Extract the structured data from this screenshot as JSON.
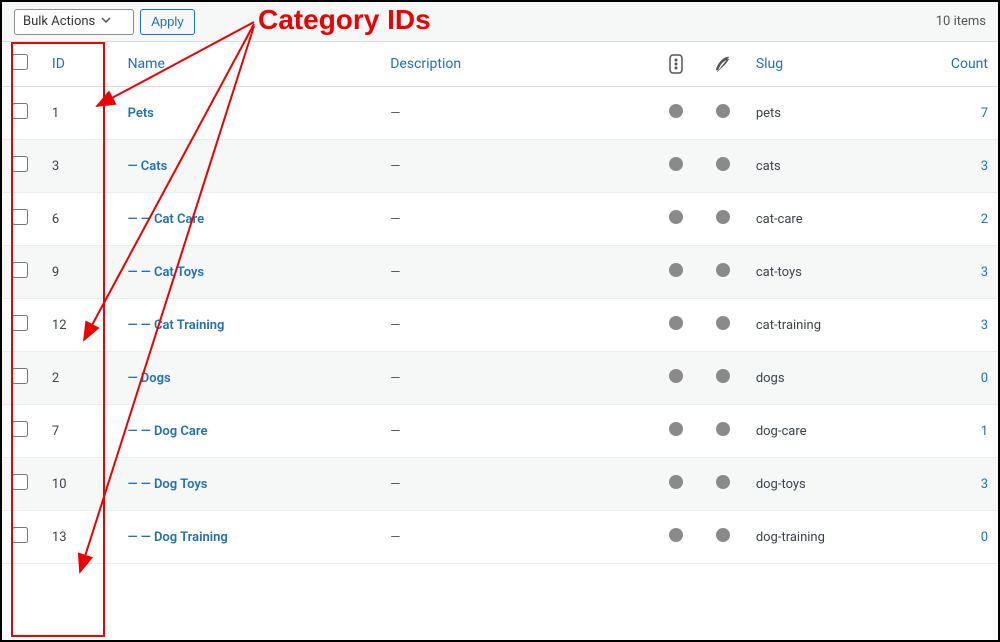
{
  "toolbar": {
    "bulk_actions_label": "Bulk Actions",
    "apply_label": "Apply",
    "items_count": "10 items"
  },
  "headers": {
    "id": "ID",
    "name": "Name",
    "description": "Description",
    "slug": "Slug",
    "count": "Count"
  },
  "rows": [
    {
      "id": "1",
      "indent": 0,
      "name": "Pets",
      "description": "—",
      "slug": "pets",
      "count": "7"
    },
    {
      "id": "3",
      "indent": 1,
      "name": "Cats",
      "description": "—",
      "slug": "cats",
      "count": "3"
    },
    {
      "id": "6",
      "indent": 2,
      "name": "Cat Care",
      "description": "—",
      "slug": "cat-care",
      "count": "2"
    },
    {
      "id": "9",
      "indent": 2,
      "name": "Cat Toys",
      "description": "—",
      "slug": "cat-toys",
      "count": "3"
    },
    {
      "id": "12",
      "indent": 2,
      "name": "Cat Training",
      "description": "—",
      "slug": "cat-training",
      "count": "3"
    },
    {
      "id": "2",
      "indent": 1,
      "name": "Dogs",
      "description": "—",
      "slug": "dogs",
      "count": "0"
    },
    {
      "id": "7",
      "indent": 2,
      "name": "Dog Care",
      "description": "—",
      "slug": "dog-care",
      "count": "1"
    },
    {
      "id": "10",
      "indent": 2,
      "name": "Dog Toys",
      "description": "—",
      "slug": "dog-toys",
      "count": "3"
    },
    {
      "id": "13",
      "indent": 2,
      "name": "Dog Training",
      "description": "—",
      "slug": "dog-training",
      "count": "0"
    }
  ],
  "annotation": {
    "label": "Category IDs"
  }
}
